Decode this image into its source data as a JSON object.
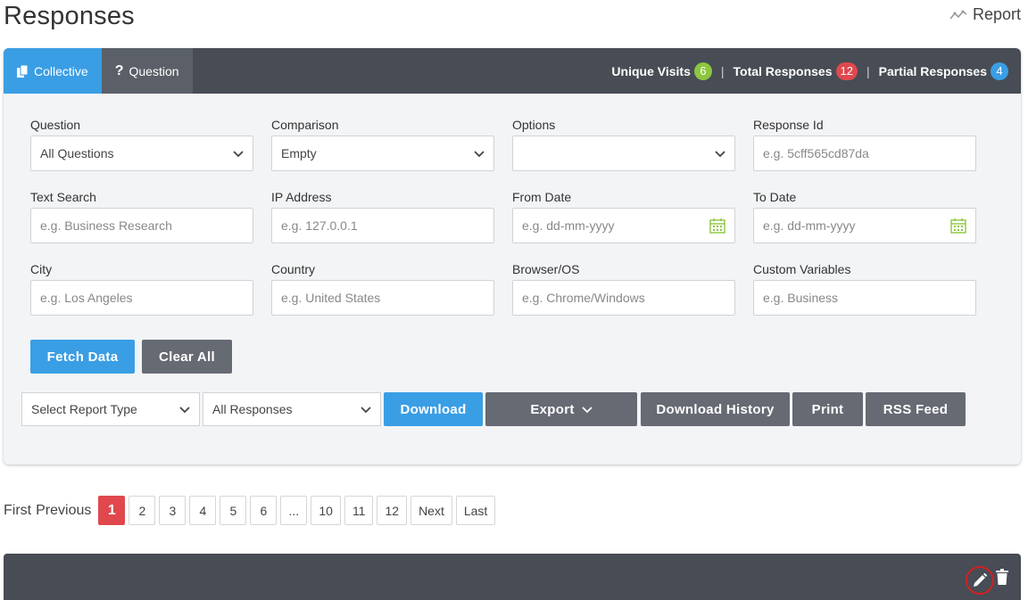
{
  "header": {
    "title": "Responses",
    "report_label": "Report"
  },
  "tabs": [
    {
      "label": "Collective",
      "icon": "copy-icon",
      "active": true
    },
    {
      "label": "Question",
      "icon": "question-icon",
      "active": false
    }
  ],
  "stats": {
    "unique_visits": {
      "label": "Unique Visits",
      "count": "6"
    },
    "total_responses": {
      "label": "Total Responses",
      "count": "12"
    },
    "partial_responses": {
      "label": "Partial Responses",
      "count": "4"
    }
  },
  "filters": {
    "question": {
      "label": "Question",
      "value": "All Questions"
    },
    "comparison": {
      "label": "Comparison",
      "value": "Empty"
    },
    "options": {
      "label": "Options",
      "value": ""
    },
    "response_id": {
      "label": "Response Id",
      "placeholder": "e.g. 5cff565cd87da"
    },
    "text_search": {
      "label": "Text Search",
      "placeholder": "e.g. Business Research"
    },
    "ip_address": {
      "label": "IP Address",
      "placeholder": "e.g. 127.0.0.1"
    },
    "from_date": {
      "label": "From Date",
      "placeholder": "e.g. dd-mm-yyyy"
    },
    "to_date": {
      "label": "To Date",
      "placeholder": "e.g. dd-mm-yyyy"
    },
    "city": {
      "label": "City",
      "placeholder": "e.g. Los Angeles"
    },
    "country": {
      "label": "Country",
      "placeholder": "e.g. United States"
    },
    "browser_os": {
      "label": "Browser/OS",
      "placeholder": "e.g. Chrome/Windows"
    },
    "custom_variables": {
      "label": "Custom Variables",
      "placeholder": "e.g. Business"
    }
  },
  "actions": {
    "fetch": "Fetch Data",
    "clear": "Clear All"
  },
  "report_bar": {
    "report_type": "Select Report Type",
    "responses_filter": "All Responses",
    "download": "Download",
    "export": "Export",
    "download_history": "Download History",
    "print": "Print",
    "rss": "RSS Feed"
  },
  "pagination": {
    "first": "First",
    "previous": "Previous",
    "pages": [
      "1",
      "2",
      "3",
      "4",
      "5",
      "6",
      "...",
      "10",
      "11",
      "12"
    ],
    "current": "1",
    "next": "Next",
    "last": "Last"
  },
  "colors": {
    "accent": "#3a9ee4",
    "header": "#474c55",
    "danger": "#e0484d",
    "success": "#8dc63f"
  }
}
